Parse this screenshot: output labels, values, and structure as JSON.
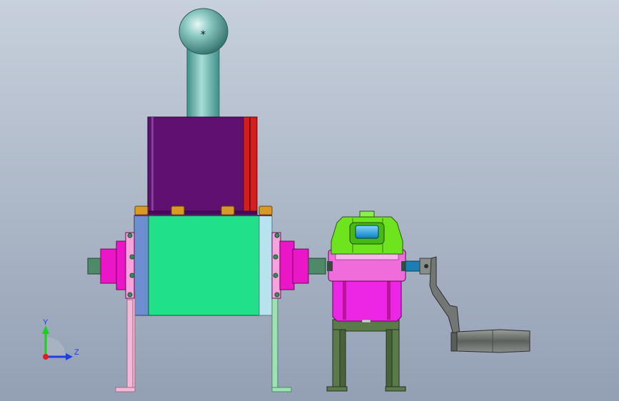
{
  "viewport": {
    "background_top": "#c7d0dc",
    "background_bottom": "#93a0b4"
  },
  "triad": {
    "y_label": "Y",
    "z_label": "Z",
    "y_color": "#1ecf1e",
    "z_color": "#1f3fe0",
    "origin_color": "#e01e1e",
    "label_color": "#1f3fe0"
  },
  "colors": {
    "knob": "#5fa9a3",
    "stem": "#6cbab4",
    "actuator_body": "#5e1170",
    "actuator_side": "#d71e1e",
    "valve_body": "#21e08a",
    "valve_left_plate": "#6d8fd0",
    "valve_right_plate": "#b8e2ee",
    "bolt": "#d99a22",
    "flange": "#ea16c8",
    "left_stand": "#f3b9d8",
    "right_stand": "#9fe0b5",
    "nozzle": "#4e8a67",
    "gearbox_top": "#6ee41e",
    "gearbox_mid": "#f06cdb",
    "gearbox_lower": "#ec26e4",
    "gearbox_window": "#1aa6e6",
    "gearbox_stand": "#5b7a49",
    "shaft": "#1d7fb0",
    "crank_arm": "#727675",
    "crank_handle": "#6c706d"
  }
}
